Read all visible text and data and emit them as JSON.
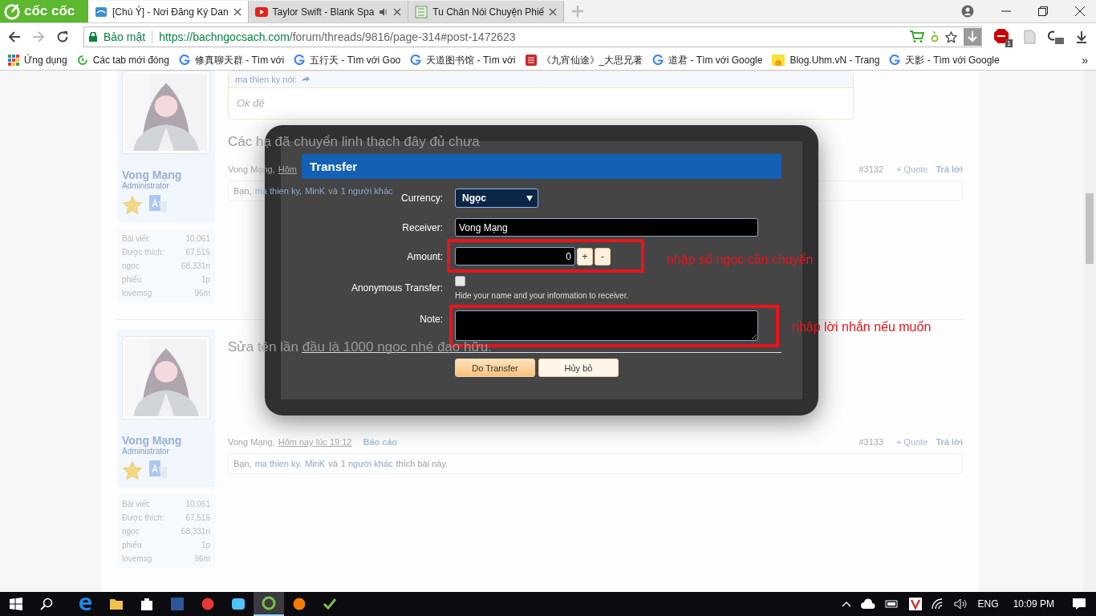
{
  "browser": {
    "logo": "cốc cốc",
    "tabs": [
      {
        "title": "[Chú Ý] - Nơi Đăng Ký Dan",
        "selected": true,
        "kind": "site"
      },
      {
        "title": "Taylor Swift - Blank Spa",
        "selected": false,
        "kind": "video",
        "audio": true
      },
      {
        "title": "Tu Chân Nói Chuyện Phiế",
        "selected": false,
        "kind": "book"
      }
    ],
    "security": "Bảo mật",
    "url_host": "https://bachngocsach.com",
    "url_path": "/forum/threads/9816/page-314#post-1472623",
    "extension_badge": "1",
    "bookmarks": [
      {
        "title": "Ứng dụng",
        "kind": "apps"
      },
      {
        "title": "Các tab mới đóng",
        "kind": "history"
      },
      {
        "title": "修真聊天群 - Tìm với",
        "kind": "google"
      },
      {
        "title": "五行天 - Tìm với Goo",
        "kind": "google"
      },
      {
        "title": "天道图书馆 - Tìm với",
        "kind": "google"
      },
      {
        "title": "《九宵仙途》_大思兄著",
        "kind": "red"
      },
      {
        "title": "道君 - Tìm với Google",
        "kind": "google"
      },
      {
        "title": "Blog.Uhm.vN - Trang",
        "kind": "sun"
      },
      {
        "title": "天影 - Tìm với Google",
        "kind": "google"
      }
    ],
    "more": "»"
  },
  "posts": [
    {
      "user": {
        "name": "Vong Mạng",
        "role": "Administrator",
        "stats": [
          {
            "label": "Bài viết:",
            "value": "10,061"
          },
          {
            "label": "Được thích:",
            "value": "67,515"
          },
          {
            "label": "ngọc",
            "value": "68,331n"
          },
          {
            "label": "phiếu",
            "value": "1p"
          },
          {
            "label": "lovemsg",
            "value": "96m"
          }
        ]
      },
      "quote": {
        "author": "ma thien ky nói:",
        "text": "Ok đệ"
      },
      "title": "Các hạ đã chuyển linh thạch đây đủ chưa",
      "author": "Vong Mạng,",
      "date": "Hôm",
      "number": "#3132",
      "quote_link": "+ Quote",
      "reply": "Trả lời",
      "likes": [
        {
          "text": "Bạn,",
          "link": false
        },
        {
          "text": "ma thien ky,",
          "link": true
        },
        {
          "text": "MinK",
          "link": true
        },
        {
          "text": "và",
          "link": false
        },
        {
          "text": "1 người khác",
          "link": true
        }
      ]
    },
    {
      "user": {
        "name": "Vong Mạng",
        "role": "Administrator",
        "stats": [
          {
            "label": "Bài viết:",
            "value": "10,061"
          },
          {
            "label": "Được thích:",
            "value": "67,515"
          },
          {
            "label": "ngọc",
            "value": "68,331n"
          },
          {
            "label": "phiếu",
            "value": "1p"
          },
          {
            "label": "lovemsg",
            "value": "96m"
          }
        ]
      },
      "title": "Sửa tên lần đầu là 1000 ngọc nhé đạo hữu.",
      "author": "Vong Mạng,",
      "date": "Hôm nay lúc 19:12",
      "report": "Báo cáo",
      "number": "#3133",
      "quote_link": "+ Quote",
      "reply": "Trả lời",
      "likes": [
        {
          "text": "Bạn,",
          "link": false
        },
        {
          "text": "ma thien ky,",
          "link": true
        },
        {
          "text": "MinK",
          "link": true
        },
        {
          "text": "và",
          "link": false
        },
        {
          "text": "1 người khác",
          "link": true
        },
        {
          "text": "thích bài này.",
          "link": false
        }
      ]
    }
  ],
  "dialog": {
    "title": "Transfer",
    "currency_label": "Currency:",
    "currency": "Ngọc",
    "receiver_label": "Receiver:",
    "receiver": "Vong Mạng",
    "amount_label": "Amount:",
    "amount": "0",
    "plus": "+",
    "minus": "-",
    "anonymous_label": "Anonymous Transfer:",
    "anonymous": false,
    "anonymous_hint": "Hide your name and your information to receiver.",
    "note_label": "Note:",
    "buttons": [
      {
        "label": "Do Transfer",
        "kind": "primary"
      },
      {
        "label": "Hủy bỏ",
        "kind": "secondary"
      }
    ]
  },
  "annotations": [
    {
      "text": "nhập số ngọc cần chuyển"
    },
    {
      "text": "nhập lời nhắn nếu muốn"
    }
  ],
  "taskbar": {
    "apps": [
      {
        "kind": "edge",
        "selected": false
      },
      {
        "kind": "folder",
        "selected": false
      },
      {
        "kind": "store",
        "selected": false
      },
      {
        "kind": "word",
        "selected": false
      },
      {
        "kind": "red",
        "selected": false
      },
      {
        "kind": "chat",
        "selected": false
      },
      {
        "kind": "coccoc",
        "selected": true
      },
      {
        "kind": "firefox",
        "selected": false
      },
      {
        "kind": "check",
        "selected": false
      }
    ],
    "language": "ENG",
    "time": "10:09 PM"
  }
}
